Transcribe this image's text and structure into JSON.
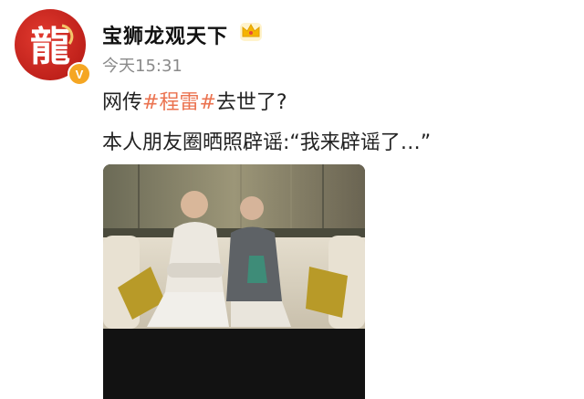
{
  "post": {
    "username": "宝狮龙观天下",
    "timestamp": "今天15:31",
    "avatar_text": "龍",
    "verified_badge": "V",
    "line1": {
      "prefix": "网传",
      "hashtag": "#程雷#",
      "suffix": "去世了?"
    },
    "line2": "本人朋友圈晒照辟谣:“我来辟谣了…”"
  },
  "colors": {
    "hashtag": "#eb7350",
    "avatar_bg": "#c8201b",
    "verified_badge": "#f5a623",
    "crown": "#f5b400"
  },
  "icons": {
    "crown": "crown-icon",
    "verified": "verified-badge-icon"
  }
}
